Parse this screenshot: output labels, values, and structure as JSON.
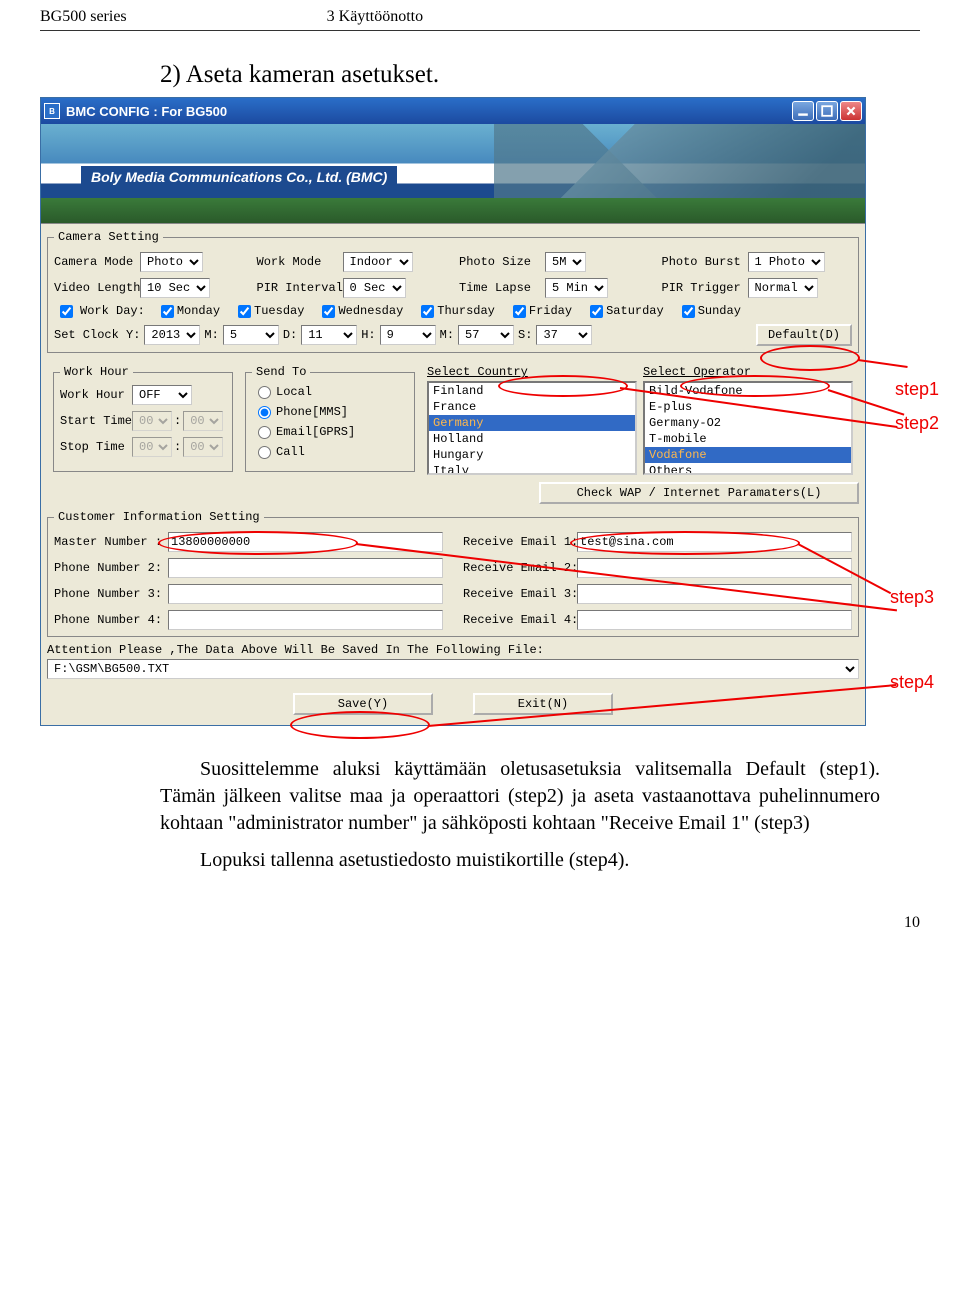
{
  "header": {
    "left": "BG500 series",
    "right": "3 Käyttöönotto"
  },
  "doc": {
    "heading": "2) Aseta kameran asetukset.",
    "para1": "Suosittelemme aluksi käyttämään oletusasetuksia valitsemalla Default (step1). Tämän jälkeen valitse maa ja operaattori (step2) ja aseta vastaanottava puhelinnumero kohtaan \"administrator number\" ja sähköposti kohtaan \"Receive Email 1\" (step3)",
    "para2": "Lopuksi tallenna asetustiedosto muistikortille (step4).",
    "pageno": "10"
  },
  "steps": {
    "s1": "step1",
    "s2": "step2",
    "s3": "step3",
    "s4": "step4"
  },
  "win": {
    "title": "BMC CONFIG : For BG500",
    "banner": "Boly Media Communications Co., Ltd. (BMC)"
  },
  "camset": {
    "legend": "Camera Setting",
    "camera_mode_l": "Camera Mode",
    "camera_mode": "Photo",
    "work_mode_l": "Work Mode",
    "work_mode": "Indoor",
    "photo_size_l": "Photo Size",
    "photo_size": "5M",
    "photo_burst_l": "Photo Burst",
    "photo_burst": "1 Photo",
    "video_length_l": "Video Length",
    "video_length": "10 Sec",
    "pir_interval_l": "PIR Interval",
    "pir_interval": "0  Sec",
    "time_lapse_l": "Time Lapse",
    "time_lapse": "5  Min",
    "pir_trigger_l": "PIR Trigger",
    "pir_trigger": "Normal",
    "work_day_l": "Work Day:",
    "days": {
      "mon": "Monday",
      "tue": "Tuesday",
      "wed": "Wednesday",
      "thu": "Thursday",
      "fri": "Friday",
      "sat": "Saturday",
      "sun": "Sunday"
    },
    "clock": {
      "set_l": "Set Clock Y:",
      "y": "2013",
      "m_l": "M:",
      "m": "5",
      "d_l": "D:",
      "d": "11",
      "h_l": "H:",
      "h": "9",
      "m2_l": "M:",
      "m2": "57",
      "s_l": "S:",
      "s": "37"
    },
    "default_btn": "Default(D)"
  },
  "workhour": {
    "legend": "Work Hour",
    "wh_l": "Work Hour",
    "wh": "OFF",
    "start_l": "Start Time",
    "start_h": "00",
    "start_m": "00",
    "stop_l": "Stop Time",
    "stop_h": "00",
    "stop_m": "00"
  },
  "sendto": {
    "legend": "Send To",
    "local": "Local",
    "phone": "Phone[MMS]",
    "email": "Email[GPRS]",
    "call": "Call"
  },
  "countries": {
    "label": "Select Country",
    "items": [
      "Finland",
      "France",
      "Germany",
      "Holland",
      "Hungary",
      "Italy"
    ],
    "selected": "Germany"
  },
  "operators": {
    "label": "Select Operator",
    "items": [
      "Bild-Vodafone",
      "E-plus",
      "Germany-O2",
      "T-mobile",
      "Vodafone",
      "Others"
    ],
    "selected": "Vodafone"
  },
  "checkparams": "Check WAP / Internet Paramaters(L)",
  "cust": {
    "legend": "Customer Information Setting",
    "master_l": "Master Number :",
    "master_v": "13800000000",
    "email1_l": "Receive Email 1:",
    "email1_v": "test@sina.com",
    "p2_l": "Phone Number 2:",
    "p2_v": "",
    "email2_l": "Receive Email 2:",
    "email2_v": "",
    "p3_l": "Phone Number 3:",
    "p3_v": "",
    "email3_l": "Receive Email 3:",
    "email3_v": "",
    "p4_l": "Phone Number 4:",
    "p4_v": "",
    "email4_l": "Receive Email 4:",
    "email4_v": ""
  },
  "attention": "Attention Please ,The Data Above Will Be Saved In The Following  File:",
  "filepath": "F:\\GSM\\BG500.TXT",
  "buttons": {
    "save": "Save(Y)",
    "exit": "Exit(N)"
  }
}
